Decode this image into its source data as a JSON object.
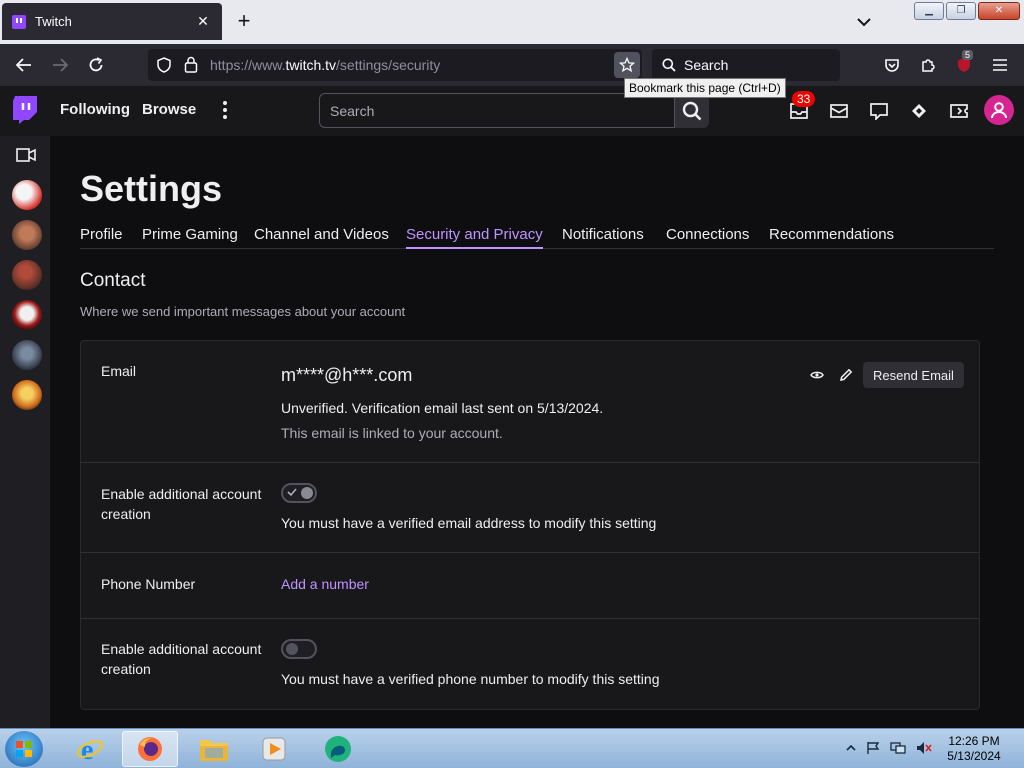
{
  "browser": {
    "tab_title": "Twitch",
    "url_prefix": "https://www.",
    "url_host": "twitch.tv",
    "url_path": "/settings/security",
    "search_label": "Search",
    "tooltip": "Bookmark this page (Ctrl+D)",
    "extension_badge": "5"
  },
  "twitch_nav": {
    "following": "Following",
    "browse": "Browse",
    "search_placeholder": "Search",
    "notification_count": "33"
  },
  "settings": {
    "title": "Settings",
    "tabs": [
      {
        "label": "Profile"
      },
      {
        "label": "Prime Gaming"
      },
      {
        "label": "Channel and Videos"
      },
      {
        "label": "Security and Privacy",
        "active": true
      },
      {
        "label": "Notifications"
      },
      {
        "label": "Connections"
      },
      {
        "label": "Recommendations"
      }
    ],
    "section_title": "Contact",
    "section_subtitle": "Where we send important messages about your account",
    "email": {
      "label": "Email",
      "value": "m****@h***.com",
      "status": "Unverified. Verification email last sent on 5/13/2024.",
      "linked": "This email is linked to your account.",
      "resend": "Resend Email"
    },
    "email_account_creation": {
      "label": "Enable additional account creation",
      "note": "You must have a verified email address to modify this setting",
      "enabled": true
    },
    "phone": {
      "label": "Phone Number",
      "link": "Add a number"
    },
    "phone_account_creation": {
      "label": "Enable additional account creation",
      "note": "You must have a verified phone number to modify this setting",
      "enabled": false
    }
  },
  "taskbar": {
    "time": "12:26 PM",
    "date": "5/13/2024"
  },
  "colors": {
    "accent": "#bf94ff",
    "brand": "#9147ff",
    "badge": "#eb0400",
    "avatar": "#d42590"
  }
}
